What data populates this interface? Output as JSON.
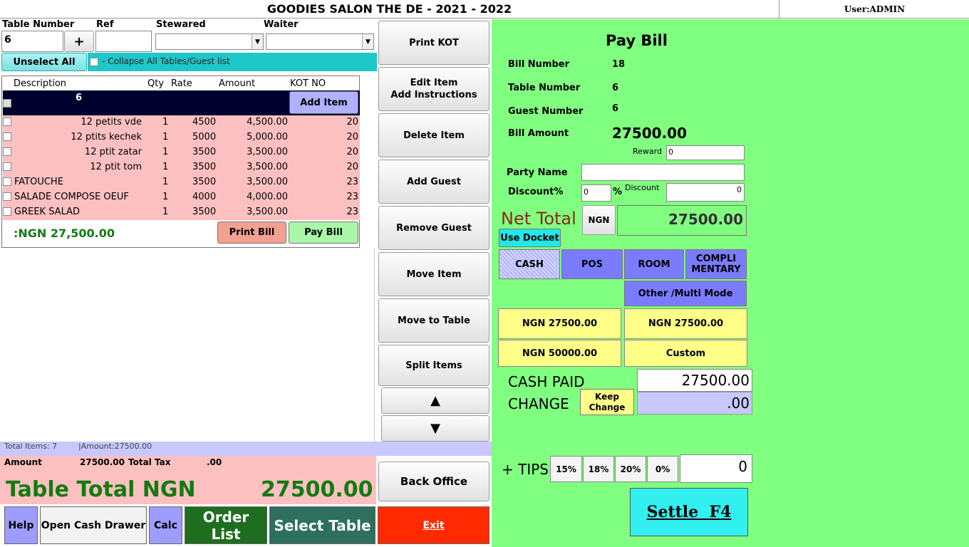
{
  "window": {
    "title": "GOODIES SALON THE DE - 2021 - 2022",
    "user": "User:ADMIN"
  },
  "top_fields": {
    "table_number_label": "Table Number",
    "table_number_value": "6",
    "plus_label": "+",
    "ref_label": "Ref",
    "ref_value": "",
    "stewared_label": "Stewared",
    "stewared_value": "",
    "waiter_label": "Waiter",
    "waiter_value": ""
  },
  "unselect_all_label": "Unselect All",
  "collapse_label": "- Collapse All Tables/Guest list",
  "grid": {
    "headers": {
      "description": "Description",
      "qty": "Qty",
      "rate": "Rate",
      "amount": "Amount",
      "kot": "KOT NO"
    },
    "guest_label": "6",
    "add_item_label": "Add Item",
    "items": [
      {
        "description": "12 petits vde",
        "qty": "1",
        "rate": "4500",
        "amount": "4,500.00",
        "kot": "20"
      },
      {
        "description": "12 ptits kechek",
        "qty": "1",
        "rate": "5000",
        "amount": "5,000.00",
        "kot": "20"
      },
      {
        "description": "12 ptit zatar",
        "qty": "1",
        "rate": "3500",
        "amount": "3,500.00",
        "kot": "20"
      },
      {
        "description": "12 ptit tom",
        "qty": "1",
        "rate": "3500",
        "amount": "3,500.00",
        "kot": "20"
      },
      {
        "description": "FATOUCHE",
        "qty": "1",
        "rate": "3500",
        "amount": "3,500.00",
        "kot": "23"
      },
      {
        "description": "SALADE COMPOSE OEUF",
        "qty": "1",
        "rate": "4000",
        "amount": "4,000.00",
        "kot": "23"
      },
      {
        "description": "GREEK SALAD",
        "qty": "1",
        "rate": "3500",
        "amount": "3,500.00",
        "kot": "23"
      }
    ],
    "subtotal": ":NGN 27,500.00",
    "print_bill_label": "Print Bill",
    "pay_bill_label": "Pay Bill"
  },
  "summary": {
    "total_items": "Total Items: 7",
    "total_amount_short": "|Amount:27500.00",
    "amount_label": "Amount",
    "amount_value": "27500.00",
    "total_tax_label": "Total Tax",
    "total_tax_value": ".00",
    "table_total_label": "Table Total NGN",
    "table_total_value": "27500.00"
  },
  "bottom_buttons": {
    "help": "Help",
    "cash_drawer": "Open Cash Drawer",
    "calc": "Calc",
    "order_list": "Order List",
    "select_table": "Select Table",
    "exit": "Exit"
  },
  "middle_buttons": {
    "print_kot": "Print KOT",
    "edit_item_line1": "Edit Item",
    "edit_item_line2": "Add Instructions",
    "delete_item": "Delete Item",
    "add_guest": "Add Guest",
    "remove_guest": "Remove Guest",
    "move_item": "Move Item",
    "move_to_table": "Move to Table",
    "split_items": "Split Items",
    "back_office": "Back Office"
  },
  "pay": {
    "title": "Pay Bill",
    "bill_number_label": "Bill Number",
    "bill_number_value": "18",
    "table_number_label": "Table Number",
    "table_number_value": "6",
    "guest_number_label": "Guest Number",
    "guest_number_value": "6",
    "bill_amount_label": "Bill Amount",
    "bill_amount_value": "27500.00",
    "reward_label": "Reward",
    "reward_value": "0",
    "party_name_label": "Party Name",
    "party_name_value": "",
    "discount_pct_label": "Discount%",
    "discount_pct_value": "0",
    "pct_sign": "%",
    "discount_label": "Discount",
    "discount_value": "0",
    "net_total_label": "Net Total",
    "currency": "NGN",
    "net_total_value": "27500.00",
    "use_docket_label": "Use Docket",
    "modes": {
      "cash": "CASH",
      "pos": "POS",
      "room": "ROOM",
      "compli_line1": "COMPLI",
      "compli_line2": "MENTARY",
      "other": "Other /Multi Mode"
    },
    "quick_amounts": [
      "NGN 27500.00",
      "NGN 27500.00",
      "NGN 50000.00",
      "Custom"
    ],
    "cash_paid_label": "CASH PAID",
    "cash_paid_value": "27500.00",
    "change_label": "CHANGE",
    "change_value": ".00",
    "keep_change_line1": "Keep",
    "keep_change_line2": "Change",
    "tips_label": "+ TIPS",
    "tips": [
      "15%",
      "18%",
      "20%",
      "0%"
    ],
    "tips_value": "0",
    "settle_label": "Settle  F4"
  },
  "colors": {
    "panel_green": "#80ff80",
    "row_pink": "#fcc0c0",
    "mode_blue": "#7b7bff",
    "quick_yellow": "#ffff88",
    "settle_cyan": "#33f0f0",
    "exit_red": "#ff2a00",
    "dark_green": "#1f6e1f"
  }
}
